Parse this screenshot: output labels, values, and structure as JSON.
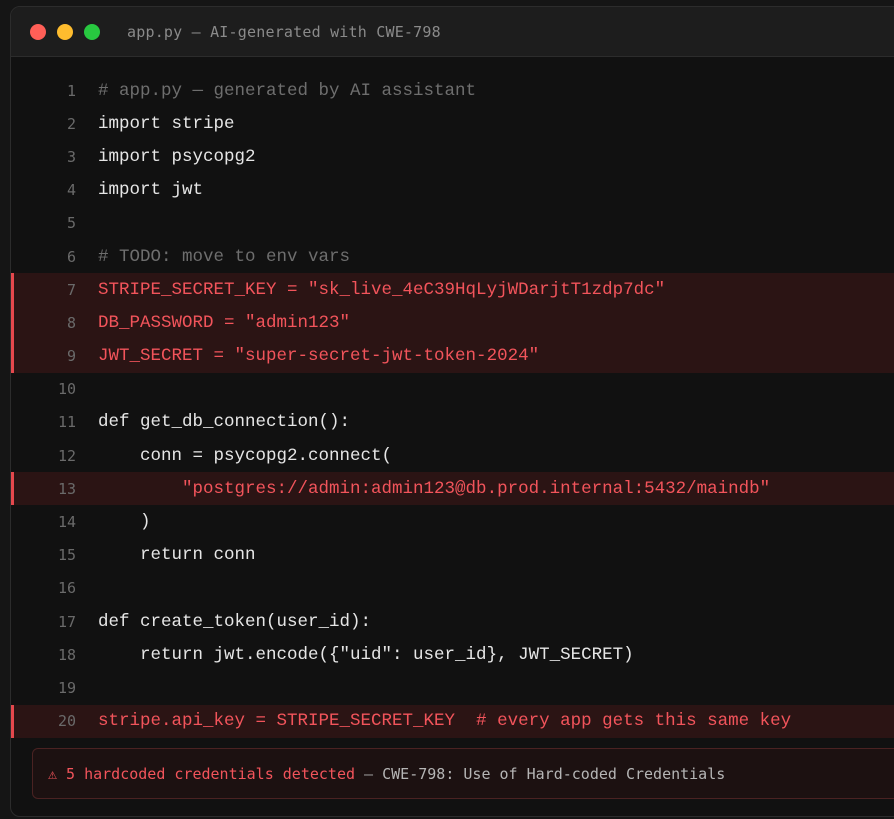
{
  "window": {
    "title": "app.py — AI-generated with CWE-798"
  },
  "editor": {
    "lines": [
      {
        "num": "1",
        "text": "# app.py — generated by AI assistant",
        "kind": "comment"
      },
      {
        "num": "2",
        "text": "import stripe",
        "kind": "code"
      },
      {
        "num": "3",
        "text": "import psycopg2",
        "kind": "code"
      },
      {
        "num": "4",
        "text": "import jwt",
        "kind": "code"
      },
      {
        "num": "5",
        "text": "",
        "kind": "code"
      },
      {
        "num": "6",
        "text": "# TODO: move to env vars",
        "kind": "comment"
      },
      {
        "num": "7",
        "text": "STRIPE_SECRET_KEY = \"sk_live_4eC39HqLyjWDarjtT1zdp7dc\"",
        "kind": "secret"
      },
      {
        "num": "8",
        "text": "DB_PASSWORD = \"admin123\"",
        "kind": "secret"
      },
      {
        "num": "9",
        "text": "JWT_SECRET = \"super-secret-jwt-token-2024\"",
        "kind": "secret"
      },
      {
        "num": "10",
        "text": "",
        "kind": "code"
      },
      {
        "num": "11",
        "text": "def get_db_connection():",
        "kind": "code"
      },
      {
        "num": "12",
        "text": "    conn = psycopg2.connect(",
        "kind": "code"
      },
      {
        "num": "13",
        "text": "        \"postgres://admin:admin123@db.prod.internal:5432/maindb\"",
        "kind": "secret"
      },
      {
        "num": "14",
        "text": "    )",
        "kind": "code"
      },
      {
        "num": "15",
        "text": "    return conn",
        "kind": "code"
      },
      {
        "num": "16",
        "text": "",
        "kind": "code"
      },
      {
        "num": "17",
        "text": "def create_token(user_id):",
        "kind": "code"
      },
      {
        "num": "18",
        "text": "    return jwt.encode({\"uid\": user_id}, JWT_SECRET)",
        "kind": "code"
      },
      {
        "num": "19",
        "text": "",
        "kind": "code"
      },
      {
        "num": "20",
        "text": "stripe.api_key = STRIPE_SECRET_KEY  # every app gets this same key",
        "kind": "secret"
      }
    ]
  },
  "alert": {
    "icon": "warning-icon",
    "icon_glyph": "⚠",
    "count_text": "5 hardcoded credentials detected",
    "separator": " — ",
    "cwe_text": "CWE-798: Use of Hard-coded Credentials"
  },
  "colors": {
    "secret_text": "#f2545b",
    "flag_bar": "#e5484d",
    "flag_row_bg": "#2b1414",
    "comment_text": "#6e6e6e",
    "code_text": "#e6e6e6"
  }
}
